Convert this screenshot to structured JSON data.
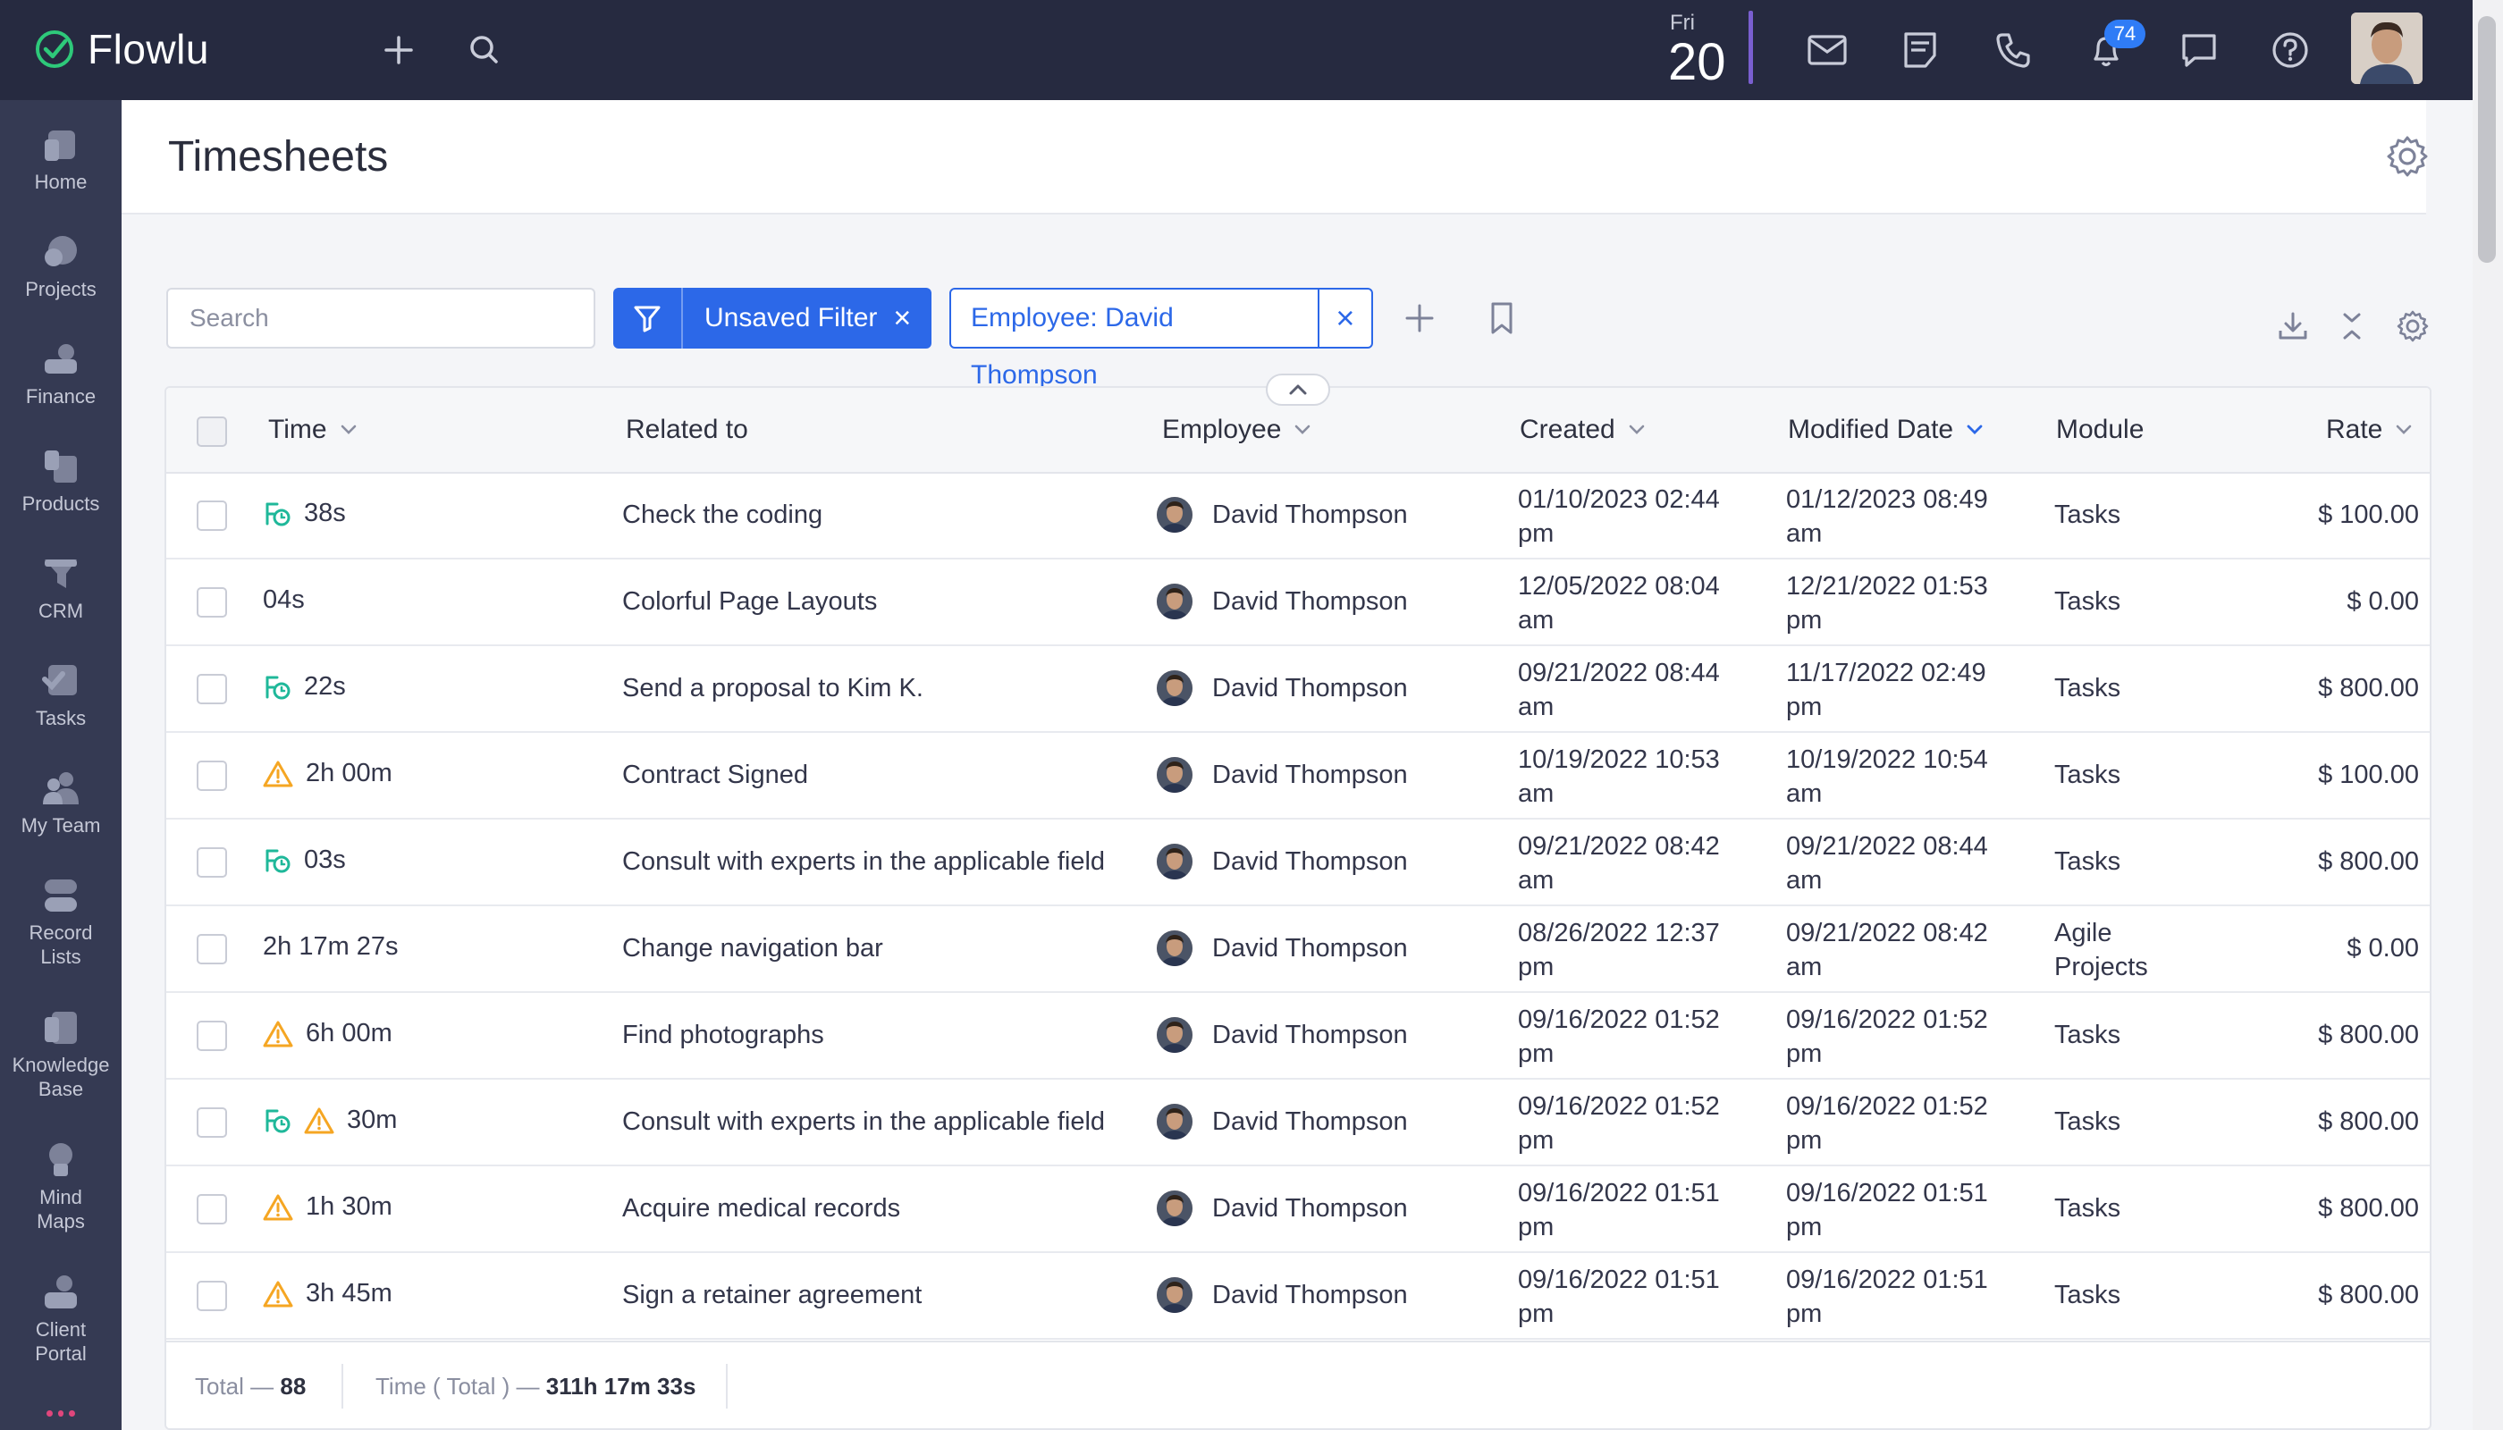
{
  "app": {
    "name": "Flowlu"
  },
  "topbar": {
    "date_dow": "Fri",
    "date_day": "20",
    "notifications_count": "74",
    "icons": [
      "plus-icon",
      "search-icon",
      "mail-icon",
      "notes-icon",
      "phone-icon",
      "bell-icon",
      "chat-icon",
      "help-icon"
    ]
  },
  "sidebar": {
    "items": [
      {
        "label": "Home",
        "icon": "home-icon"
      },
      {
        "label": "Projects",
        "icon": "projects-icon"
      },
      {
        "label": "Finance",
        "icon": "finance-icon"
      },
      {
        "label": "Products",
        "icon": "products-icon"
      },
      {
        "label": "CRM",
        "icon": "crm-icon"
      },
      {
        "label": "Tasks",
        "icon": "tasks-icon"
      },
      {
        "label": "My Team",
        "icon": "team-icon"
      },
      {
        "label": "Record Lists",
        "icon": "record-lists-icon"
      },
      {
        "label": "Knowledge Base",
        "icon": "knowledge-base-icon"
      },
      {
        "label": "Mind Maps",
        "icon": "mind-maps-icon"
      },
      {
        "label": "Client Portal",
        "icon": "client-portal-icon"
      }
    ]
  },
  "page": {
    "title": "Timesheets"
  },
  "toolbar": {
    "search_placeholder": "Search",
    "filter_label": "Unsaved Filter",
    "filter_remove": "×",
    "chip_label": "Employee: David Thompson",
    "chip_remove": "×"
  },
  "table": {
    "columns": {
      "time": "Time",
      "related": "Related to",
      "employee": "Employee",
      "created": "Created",
      "modified": "Modified Date",
      "module": "Module",
      "rate": "Rate"
    },
    "rows": [
      {
        "icons": [
          "timer"
        ],
        "time": "38s",
        "related": "Check the coding",
        "employee": "David Thompson",
        "created_1": "01/10/2023 02:44",
        "created_2": "pm",
        "modified_1": "01/12/2023 08:49",
        "modified_2": "am",
        "module_1": "Tasks",
        "module_2": "",
        "rate": "$ 100.00"
      },
      {
        "icons": [],
        "time": "04s",
        "related": "Colorful Page Layouts",
        "employee": "David Thompson",
        "created_1": "12/05/2022 08:04",
        "created_2": "am",
        "modified_1": "12/21/2022 01:53",
        "modified_2": "pm",
        "module_1": "Tasks",
        "module_2": "",
        "rate": "$ 0.00"
      },
      {
        "icons": [
          "timer"
        ],
        "time": "22s",
        "related": "Send a proposal to Kim K.",
        "employee": "David Thompson",
        "created_1": "09/21/2022 08:44",
        "created_2": "am",
        "modified_1": "11/17/2022 02:49",
        "modified_2": "pm",
        "module_1": "Tasks",
        "module_2": "",
        "rate": "$ 800.00"
      },
      {
        "icons": [
          "warning"
        ],
        "time": "2h 00m",
        "related": "Contract Signed",
        "employee": "David Thompson",
        "created_1": "10/19/2022 10:53",
        "created_2": "am",
        "modified_1": "10/19/2022 10:54",
        "modified_2": "am",
        "module_1": "Tasks",
        "module_2": "",
        "rate": "$ 100.00"
      },
      {
        "icons": [
          "timer"
        ],
        "time": "03s",
        "related": "Consult with experts in the applicable field",
        "employee": "David Thompson",
        "created_1": "09/21/2022 08:42",
        "created_2": "am",
        "modified_1": "09/21/2022 08:44",
        "modified_2": "am",
        "module_1": "Tasks",
        "module_2": "",
        "rate": "$ 800.00"
      },
      {
        "icons": [],
        "time": "2h 17m 27s",
        "related": "Change navigation bar",
        "employee": "David Thompson",
        "created_1": "08/26/2022 12:37",
        "created_2": "pm",
        "modified_1": "09/21/2022 08:42",
        "modified_2": "am",
        "module_1": "Agile",
        "module_2": "Projects",
        "rate": "$ 0.00"
      },
      {
        "icons": [
          "warning"
        ],
        "time": "6h 00m",
        "related": "Find photographs",
        "employee": "David Thompson",
        "created_1": "09/16/2022 01:52",
        "created_2": "pm",
        "modified_1": "09/16/2022 01:52",
        "modified_2": "pm",
        "module_1": "Tasks",
        "module_2": "",
        "rate": "$ 800.00"
      },
      {
        "icons": [
          "timer",
          "warning"
        ],
        "time": "30m",
        "related": "Consult with experts in the applicable field",
        "employee": "David Thompson",
        "created_1": "09/16/2022 01:52",
        "created_2": "pm",
        "modified_1": "09/16/2022 01:52",
        "modified_2": "pm",
        "module_1": "Tasks",
        "module_2": "",
        "rate": "$ 800.00"
      },
      {
        "icons": [
          "warning"
        ],
        "time": "1h 30m",
        "related": "Acquire medical records",
        "employee": "David Thompson",
        "created_1": "09/16/2022 01:51",
        "created_2": "pm",
        "modified_1": "09/16/2022 01:51",
        "modified_2": "pm",
        "module_1": "Tasks",
        "module_2": "",
        "rate": "$ 800.00"
      },
      {
        "icons": [
          "warning"
        ],
        "time": "3h 45m",
        "related": "Sign a retainer agreement",
        "employee": "David Thompson",
        "created_1": "09/16/2022 01:51",
        "created_2": "pm",
        "modified_1": "09/16/2022 01:51",
        "modified_2": "pm",
        "module_1": "Tasks",
        "module_2": "",
        "rate": "$ 800.00"
      }
    ]
  },
  "footer": {
    "total_label": "Total —",
    "total_value": "88",
    "time_label": "Time ( Total ) —",
    "time_value": "311h 17m 33s"
  },
  "colors": {
    "topbar": "#262a40",
    "sidebar": "#353a53",
    "accent": "#2c68e8",
    "timer_icon": "#1fb89a",
    "warning_icon": "#f5a623",
    "date_bar": "#7a5fd0"
  }
}
